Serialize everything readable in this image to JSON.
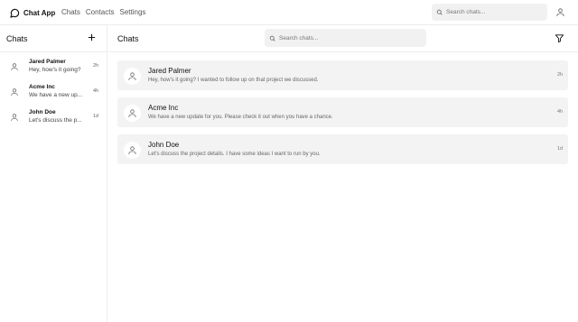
{
  "header": {
    "app_name": "Chat App",
    "nav": [
      "Chats",
      "Contacts",
      "Settings"
    ],
    "search_placeholder": "Search chats..."
  },
  "sidebar": {
    "title": "Chats",
    "chats": [
      {
        "name": "Jared Palmer",
        "preview": "Hey, how's it going?",
        "time": "2h"
      },
      {
        "name": "Acme Inc",
        "preview": "We have a new up...",
        "time": "4h"
      },
      {
        "name": "John Doe",
        "preview": "Let's discuss the p...",
        "time": "1d"
      }
    ]
  },
  "main": {
    "title": "Chats",
    "search_placeholder": "Search chats...",
    "conversations": [
      {
        "name": "Jared Palmer",
        "preview": "Hey, how's it going? I wanted to follow up on that project we discussed.",
        "time": "2h"
      },
      {
        "name": "Acme Inc",
        "preview": "We have a new update for you. Please check it out when you have a chance.",
        "time": "4h"
      },
      {
        "name": "John Doe",
        "preview": "Let's discuss the project details. I have some ideas I want to run by you.",
        "time": "1d"
      }
    ]
  },
  "icons": {
    "brand": "chat-bubble-icon",
    "search": "search-icon",
    "user": "user-icon",
    "add": "plus-icon",
    "filter": "filter-icon"
  }
}
